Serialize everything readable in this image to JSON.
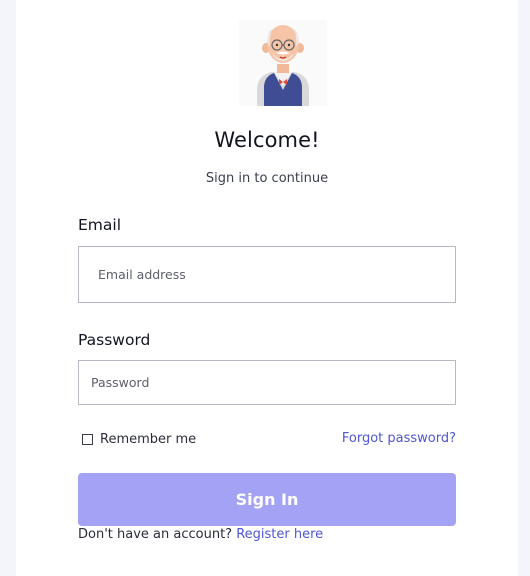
{
  "avatar": {
    "icon": "old-man-avatar-icon"
  },
  "header": {
    "title": "Welcome!",
    "subtitle": "Sign in to continue"
  },
  "form": {
    "email_label": "Email",
    "email_placeholder": "Email address",
    "email_value": "",
    "password_label": "Password",
    "password_placeholder": "Password",
    "password_value": "",
    "remember_label": "Remember me",
    "remember_checked": false,
    "forgot_label": "Forgot password?",
    "submit_label": "Sign In"
  },
  "footer": {
    "prompt": "Don't have an account?",
    "register_label": "Register here"
  },
  "colors": {
    "accent": "#4f56d6",
    "button_bg": "#a3a2f4",
    "page_bg": "#f4f5fb"
  }
}
